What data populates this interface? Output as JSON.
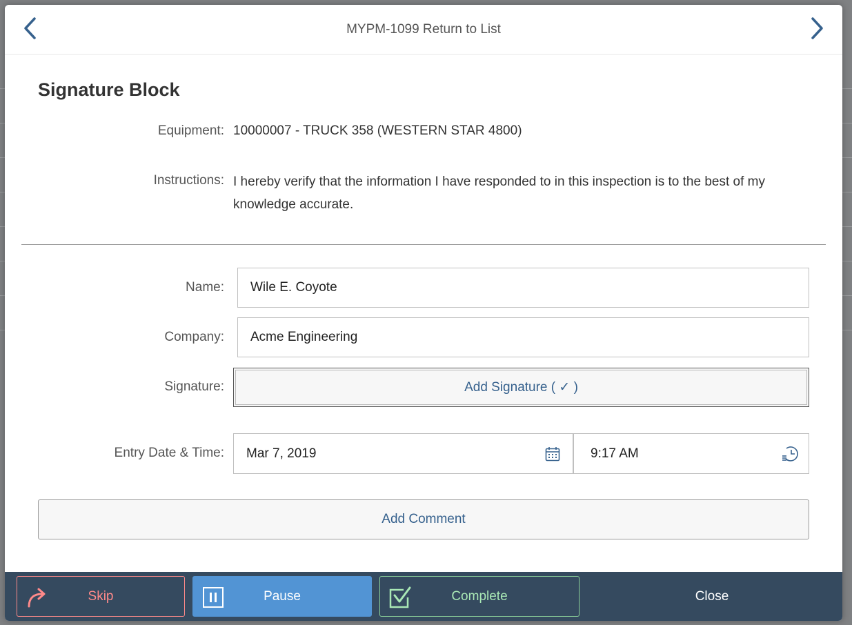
{
  "header": {
    "title": "MYPM-1099 Return to List",
    "prev_icon": "chevron-left-icon",
    "next_icon": "chevron-right-icon"
  },
  "section": {
    "title": "Signature Block"
  },
  "equipment": {
    "label": "Equipment:",
    "value": "10000007 - TRUCK 358 (WESTERN STAR 4800)"
  },
  "instructions": {
    "label": "Instructions:",
    "value": "I hereby verify that the information I have responded to in this inspection is to the best of my knowledge accurate."
  },
  "form": {
    "name": {
      "label": "Name:",
      "value": "Wile E. Coyote"
    },
    "company": {
      "label": "Company:",
      "value": "Acme Engineering"
    },
    "signature": {
      "label": "Signature:",
      "button": "Add Signature ( ✓ )"
    },
    "entry": {
      "label": "Entry Date & Time:",
      "date": "Mar 7, 2019",
      "time": "9:17 AM",
      "date_icon": "calendar-icon",
      "time_icon": "clock-icon"
    },
    "comment_button": "Add Comment"
  },
  "footer": {
    "skip": "Skip",
    "pause": "Pause",
    "complete": "Complete",
    "close": "Close"
  },
  "colors": {
    "footer_bg": "#354a5f",
    "accent_blue": "#36618d",
    "pause_bg": "#5294d4",
    "skip": "#ff8a8a",
    "complete": "#8bd09a"
  }
}
